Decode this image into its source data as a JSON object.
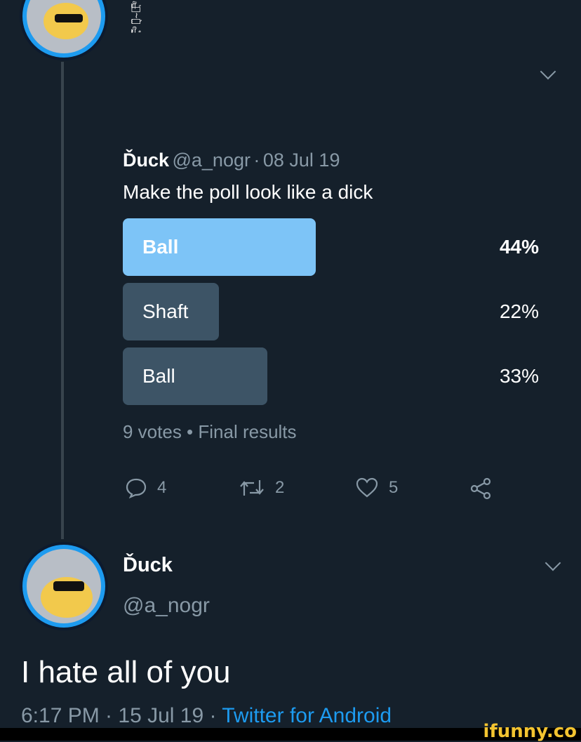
{
  "quoted_tweet": {
    "glitch_name": "ₐ̶͚͇͛ꙩ̴̫̀⃕ₑ̵̛̰͓͖͑",
    "display_name": "Ďuck",
    "handle": "@a_nogr",
    "date": "08 Jul 19",
    "separator": "·",
    "text": "Make the poll look like a dick",
    "poll": {
      "options": [
        {
          "label": "Ball",
          "percent_text": "44%",
          "percent": 44,
          "leading": true
        },
        {
          "label": "Shaft",
          "percent_text": "22%",
          "percent": 22,
          "leading": false
        },
        {
          "label": "Ball",
          "percent_text": "33%",
          "percent": 33,
          "leading": false
        }
      ],
      "summary": "9 votes • Final results"
    },
    "actions": {
      "replies": "4",
      "retweets": "2",
      "likes": "5"
    }
  },
  "main_tweet": {
    "display_name": "Ďuck",
    "handle": "@a_nogr",
    "text": "I hate all of you",
    "time": "6:17 PM · 15 Jul 19 · ",
    "client": "Twitter for Android"
  },
  "watermark": "ifunny.co",
  "colors": {
    "background": "#15202b",
    "poll_leading": "#7dc4f7",
    "poll_other": "#3d5466",
    "muted": "#8899a6",
    "link": "#1d9bf0",
    "watermark": "#f4c430"
  },
  "icons": [
    "reply-icon",
    "retweet-icon",
    "like-icon",
    "share-icon",
    "chevron-down-icon"
  ]
}
